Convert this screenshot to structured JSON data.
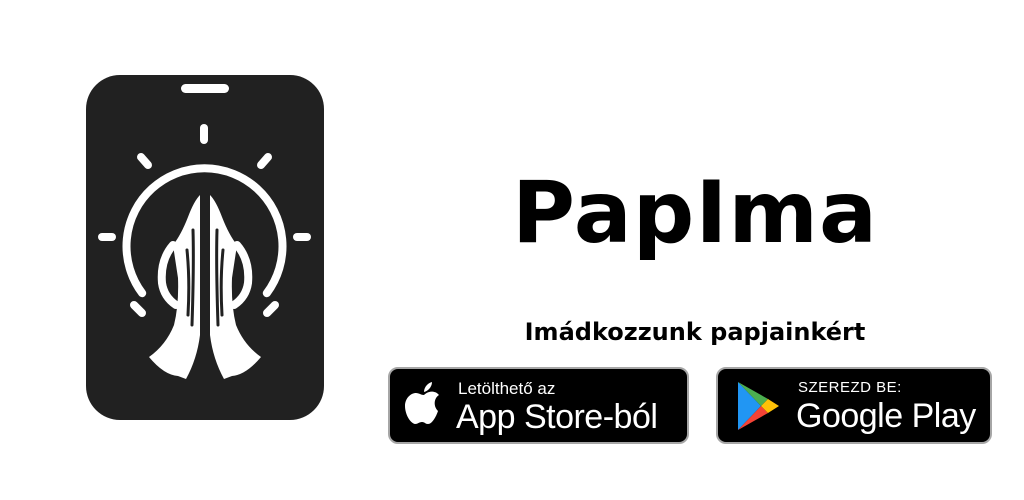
{
  "app": {
    "name": "PapIma",
    "tagline": "Imádkozzunk papjainkért"
  },
  "logo": {
    "icon": "praying-hands-phone-icon",
    "colors": {
      "background": "#212121",
      "foreground": "#ffffff"
    }
  },
  "badges": {
    "app_store": {
      "small_label": "Letölthető az",
      "big_label": "App Store-ból",
      "icon": "apple-icon"
    },
    "google_play": {
      "small_label": "SZEREZD BE:",
      "big_label": "Google Play",
      "icon": "google-play-icon"
    },
    "colors": {
      "background": "#000000",
      "border": "#a6a6a6",
      "text": "#ffffff"
    }
  }
}
